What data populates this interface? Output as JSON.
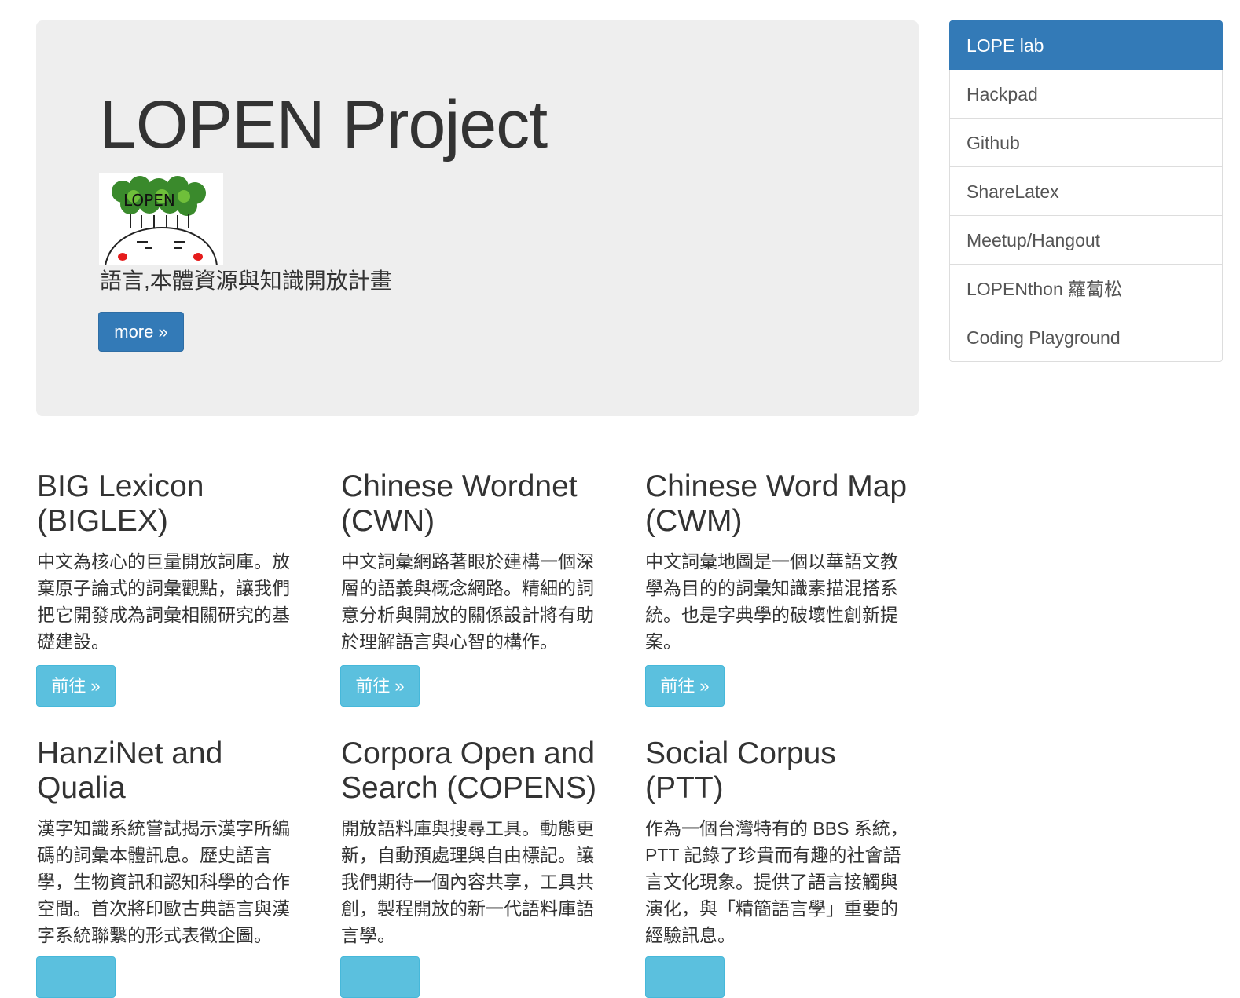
{
  "jumbotron": {
    "title": "LOPEN Project",
    "logo_text": "LOPEN",
    "description": "語言,本體資源與知識開放計畫",
    "more_label": "more »"
  },
  "sidebar": {
    "items": [
      {
        "label": "LOPE lab",
        "active": true
      },
      {
        "label": "Hackpad"
      },
      {
        "label": "Github"
      },
      {
        "label": "ShareLatex"
      },
      {
        "label": "Meetup/Hangout"
      },
      {
        "label": "LOPENthon 蘿蔔松"
      },
      {
        "label": "Coding Playground"
      }
    ]
  },
  "projects": [
    {
      "title": "BIG Lexicon (BIGLEX)",
      "description": "中文為核心的巨量開放詞庫。放棄原子論式的詞彙觀點，讓我們把它開發成為詞彙相關研究的基礎建設。",
      "button": "前往 »"
    },
    {
      "title": "Chinese Wordnet (CWN)",
      "description": "中文詞彙網路著眼於建構一個深層的語義與概念網路。精細的詞意分析與開放的關係設計將有助於理解語言與心智的構作。",
      "button": "前往 »"
    },
    {
      "title": "Chinese Word Map (CWM)",
      "description": "中文詞彙地圖是一個以華語文教學為目的的詞彙知識素描混搭系統。也是字典學的破壞性創新提案。",
      "button": "前往 »"
    },
    {
      "title": "HanziNet and Qualia",
      "description": "漢字知識系統嘗試揭示漢字所編碼的詞彙本體訊息。歷史語言學，生物資訊和認知科學的合作空間。首次將印歐古典語言與漢字系統聯繫的形式表徵企圖。"
    },
    {
      "title": "Corpora Open and Search (COPENS)",
      "description": "開放語料庫與搜尋工具。動態更新，自動預處理與自由標記。讓我們期待一個內容共享，工具共創，製程開放的新一代語料庫語言學。"
    },
    {
      "title": "Social Corpus (PTT)",
      "description": "作為一個台灣特有的 BBS 系統，PTT 記錄了珍貴而有趣的社會語言文化現象。提供了語言接觸與演化，與「精簡語言學」重要的經驗訊息。"
    }
  ]
}
